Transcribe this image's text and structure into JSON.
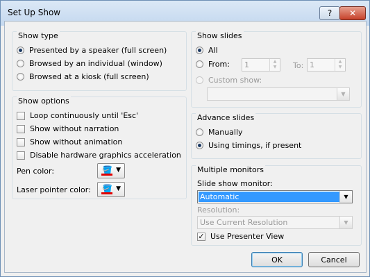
{
  "window": {
    "title": "Set Up Show",
    "help_label": "?",
    "close_label": "✕"
  },
  "show_type": {
    "title": "Show type",
    "options": [
      {
        "label": "Presented by a speaker (full screen)",
        "selected": true
      },
      {
        "label": "Browsed by an individual (window)",
        "selected": false
      },
      {
        "label": "Browsed at a kiosk (full screen)",
        "selected": false
      }
    ]
  },
  "show_options": {
    "title": "Show options",
    "checks": [
      {
        "label": "Loop continuously until 'Esc'",
        "checked": false
      },
      {
        "label": "Show without narration",
        "checked": false
      },
      {
        "label": "Show without animation",
        "checked": false
      },
      {
        "label": "Disable hardware graphics acceleration",
        "checked": false
      }
    ],
    "pen_color_label": "Pen color:",
    "laser_color_label": "Laser pointer color:",
    "pen_color": "#e00000",
    "laser_color": "#e00000"
  },
  "show_slides": {
    "title": "Show slides",
    "all_label": "All",
    "from_label": "From:",
    "to_label": "To:",
    "from_value": "1",
    "to_value": "1",
    "custom_label": "Custom show:",
    "custom_value": ""
  },
  "advance_slides": {
    "title": "Advance slides",
    "manual_label": "Manually",
    "timings_label": "Using timings, if present",
    "selected": "timings"
  },
  "monitors": {
    "title": "Multiple monitors",
    "monitor_label": "Slide show monitor:",
    "monitor_value": "Automatic",
    "resolution_label": "Resolution:",
    "resolution_value": "Use Current Resolution",
    "presenter_label": "Use Presenter View",
    "presenter_checked": true
  },
  "buttons": {
    "ok": "OK",
    "cancel": "Cancel"
  }
}
